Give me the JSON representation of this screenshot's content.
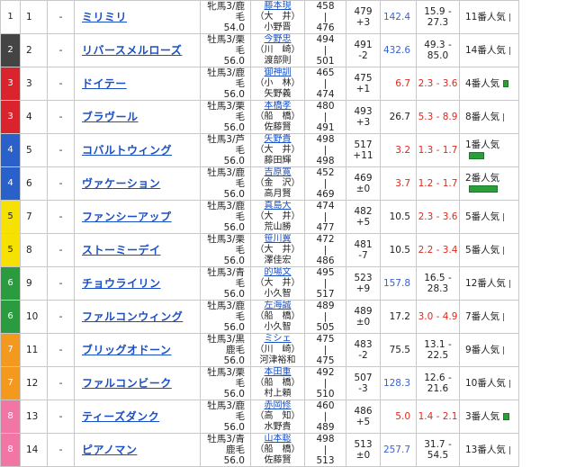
{
  "colors": {
    "waku1": "#ffffff",
    "waku2": "#444444",
    "waku3": "#d9232d",
    "waku4": "#2960c9",
    "waku5": "#f6e100",
    "waku6": "#2a9b3f",
    "waku7": "#f39a1e",
    "waku8": "#f276a5",
    "link": "#1a4fc4",
    "red": "#e0281e",
    "bar": "#2b9e3a"
  },
  "rows": [
    {
      "waku": "1",
      "num": "1",
      "mark": "-",
      "name": "ミリミリ",
      "sex": "牝馬3/鹿毛",
      "kg": "54.0",
      "jockey": "藤本現",
      "stable": "（大　井）",
      "trainer": "小野晋",
      "weight_top": "458",
      "weight_bot": "476",
      "body": "479",
      "diff": "+3",
      "odds": "142.4",
      "odds_color": "blue",
      "range": "15.9 - 27.3",
      "range_color": "",
      "pop": "11番人気",
      "bar": 0
    },
    {
      "waku": "2",
      "num": "2",
      "mark": "-",
      "name": "リバースメルローズ",
      "sex": "牡馬3/栗毛",
      "kg": "56.0",
      "jockey": "今野忠",
      "stable": "（川　崎）",
      "trainer": "渡部則",
      "weight_top": "494",
      "weight_bot": "501",
      "body": "491",
      "diff": "-2",
      "odds": "432.6",
      "odds_color": "blue",
      "range": "49.3 - 85.0",
      "range_color": "",
      "pop": "14番人気",
      "bar": 0
    },
    {
      "waku": "3",
      "num": "3",
      "mark": "-",
      "name": "ドイテー",
      "sex": "牡馬3/鹿毛",
      "kg": "56.0",
      "jockey": "御神訓",
      "stable": "（小　林）",
      "trainer": "矢野義",
      "weight_top": "465",
      "weight_bot": "474",
      "body": "475",
      "diff": "+1",
      "odds": "6.7",
      "odds_color": "red",
      "range": "2.3 - 3.6",
      "range_color": "red",
      "pop": "4番人気",
      "bar": 0.12
    },
    {
      "waku": "3",
      "num": "4",
      "mark": "-",
      "name": "ブラヴール",
      "sex": "牡馬3/栗毛",
      "kg": "56.0",
      "jockey": "本橋孝",
      "stable": "（船　橋）",
      "trainer": "佐藤賢",
      "weight_top": "480",
      "weight_bot": "491",
      "body": "493",
      "diff": "+3",
      "odds": "26.7",
      "odds_color": "",
      "range": "5.3 - 8.9",
      "range_color": "red",
      "pop": "8番人気",
      "bar": 0
    },
    {
      "waku": "4",
      "num": "5",
      "mark": "-",
      "name": "コバルトウィング",
      "sex": "牡馬3/芦毛",
      "kg": "56.0",
      "jockey": "矢野貴",
      "stable": "（大　井）",
      "trainer": "藤田輝",
      "weight_top": "498",
      "weight_bot": "498",
      "body": "517",
      "diff": "+11",
      "odds": "3.2",
      "odds_color": "red",
      "range": "1.3 - 1.7",
      "range_color": "red",
      "pop": "1番人気",
      "bar": 0.5
    },
    {
      "waku": "4",
      "num": "6",
      "mark": "-",
      "name": "ヴァケーション",
      "sex": "牡馬3/鹿毛",
      "kg": "56.0",
      "jockey": "吉原寛",
      "stable": "（金　沢）",
      "trainer": "高月賢",
      "weight_top": "452",
      "weight_bot": "469",
      "body": "469",
      "diff": "±0",
      "odds": "3.7",
      "odds_color": "red",
      "range": "1.2 - 1.7",
      "range_color": "red",
      "pop": "2番人気",
      "bar": 1.0
    },
    {
      "waku": "5",
      "num": "7",
      "mark": "-",
      "name": "ファンシーアップ",
      "sex": "牡馬3/鹿毛",
      "kg": "56.0",
      "jockey": "真島大",
      "stable": "（大　井）",
      "trainer": "荒山勝",
      "weight_top": "474",
      "weight_bot": "477",
      "body": "482",
      "diff": "+5",
      "odds": "10.5",
      "odds_color": "",
      "range": "2.3 - 3.6",
      "range_color": "red",
      "pop": "5番人気",
      "bar": 0
    },
    {
      "waku": "5",
      "num": "8",
      "mark": "-",
      "name": "ストーミーデイ",
      "sex": "牡馬3/栗毛",
      "kg": "56.0",
      "jockey": "笹川翼",
      "stable": "（大　井）",
      "trainer": "澤佳宏",
      "weight_top": "472",
      "weight_bot": "486",
      "body": "481",
      "diff": "-7",
      "odds": "10.5",
      "odds_color": "",
      "range": "2.2 - 3.4",
      "range_color": "red",
      "pop": "5番人気",
      "bar": 0
    },
    {
      "waku": "6",
      "num": "9",
      "mark": "-",
      "name": "チョウライリン",
      "sex": "牡馬3/青毛",
      "kg": "56.0",
      "jockey": "的場文",
      "stable": "（大　井）",
      "trainer": "小久智",
      "weight_top": "495",
      "weight_bot": "517",
      "body": "523",
      "diff": "+9",
      "odds": "157.8",
      "odds_color": "blue",
      "range": "16.5 - 28.3",
      "range_color": "",
      "pop": "12番人気",
      "bar": 0
    },
    {
      "waku": "6",
      "num": "10",
      "mark": "-",
      "name": "ファルコンウィング",
      "sex": "牡馬3/鹿毛",
      "kg": "56.0",
      "jockey": "左海誠",
      "stable": "（船　橋）",
      "trainer": "小久智",
      "weight_top": "489",
      "weight_bot": "505",
      "body": "489",
      "diff": "±0",
      "odds": "17.2",
      "odds_color": "",
      "range": "3.0 - 4.9",
      "range_color": "red",
      "pop": "7番人気",
      "bar": 0
    },
    {
      "waku": "7",
      "num": "11",
      "mark": "-",
      "name": "ブリッグオドーン",
      "sex": "牡馬3/黒鹿毛",
      "kg": "56.0",
      "jockey": "ミシェ",
      "stable": "（川　崎）",
      "trainer": "河津裕和",
      "weight_top": "475",
      "weight_bot": "475",
      "body": "483",
      "diff": "-2",
      "odds": "75.5",
      "odds_color": "",
      "range": "13.1 - 22.5",
      "range_color": "",
      "pop": "9番人気",
      "bar": 0
    },
    {
      "waku": "7",
      "num": "12",
      "mark": "-",
      "name": "ファルコンビーク",
      "sex": "牡馬3/栗毛",
      "kg": "56.0",
      "jockey": "本田重",
      "stable": "（船　橋）",
      "trainer": "村上頼",
      "weight_top": "492",
      "weight_bot": "510",
      "body": "507",
      "diff": "-3",
      "odds": "128.3",
      "odds_color": "blue",
      "range": "12.6 - 21.6",
      "range_color": "",
      "pop": "10番人気",
      "bar": 0
    },
    {
      "waku": "8",
      "num": "13",
      "mark": "-",
      "name": "ティーズダンク",
      "sex": "牡馬3/鹿毛",
      "kg": "56.0",
      "jockey": "赤岡修",
      "stable": "（高　知）",
      "trainer": "水野貴",
      "weight_top": "460",
      "weight_bot": "489",
      "body": "486",
      "diff": "+5",
      "odds": "5.0",
      "odds_color": "red",
      "range": "1.4 - 2.1",
      "range_color": "red",
      "pop": "3番人気",
      "bar": 0.15
    },
    {
      "waku": "8",
      "num": "14",
      "mark": "-",
      "name": "ピアノマン",
      "sex": "牡馬3/青鹿毛",
      "kg": "56.0",
      "jockey": "山本聡",
      "stable": "（船　橋）",
      "trainer": "佐藤賢",
      "weight_top": "498",
      "weight_bot": "513",
      "body": "513",
      "diff": "±0",
      "odds": "257.7",
      "odds_color": "blue",
      "range": "31.7 - 54.5",
      "range_color": "",
      "pop": "13番人気",
      "bar": 0
    }
  ]
}
